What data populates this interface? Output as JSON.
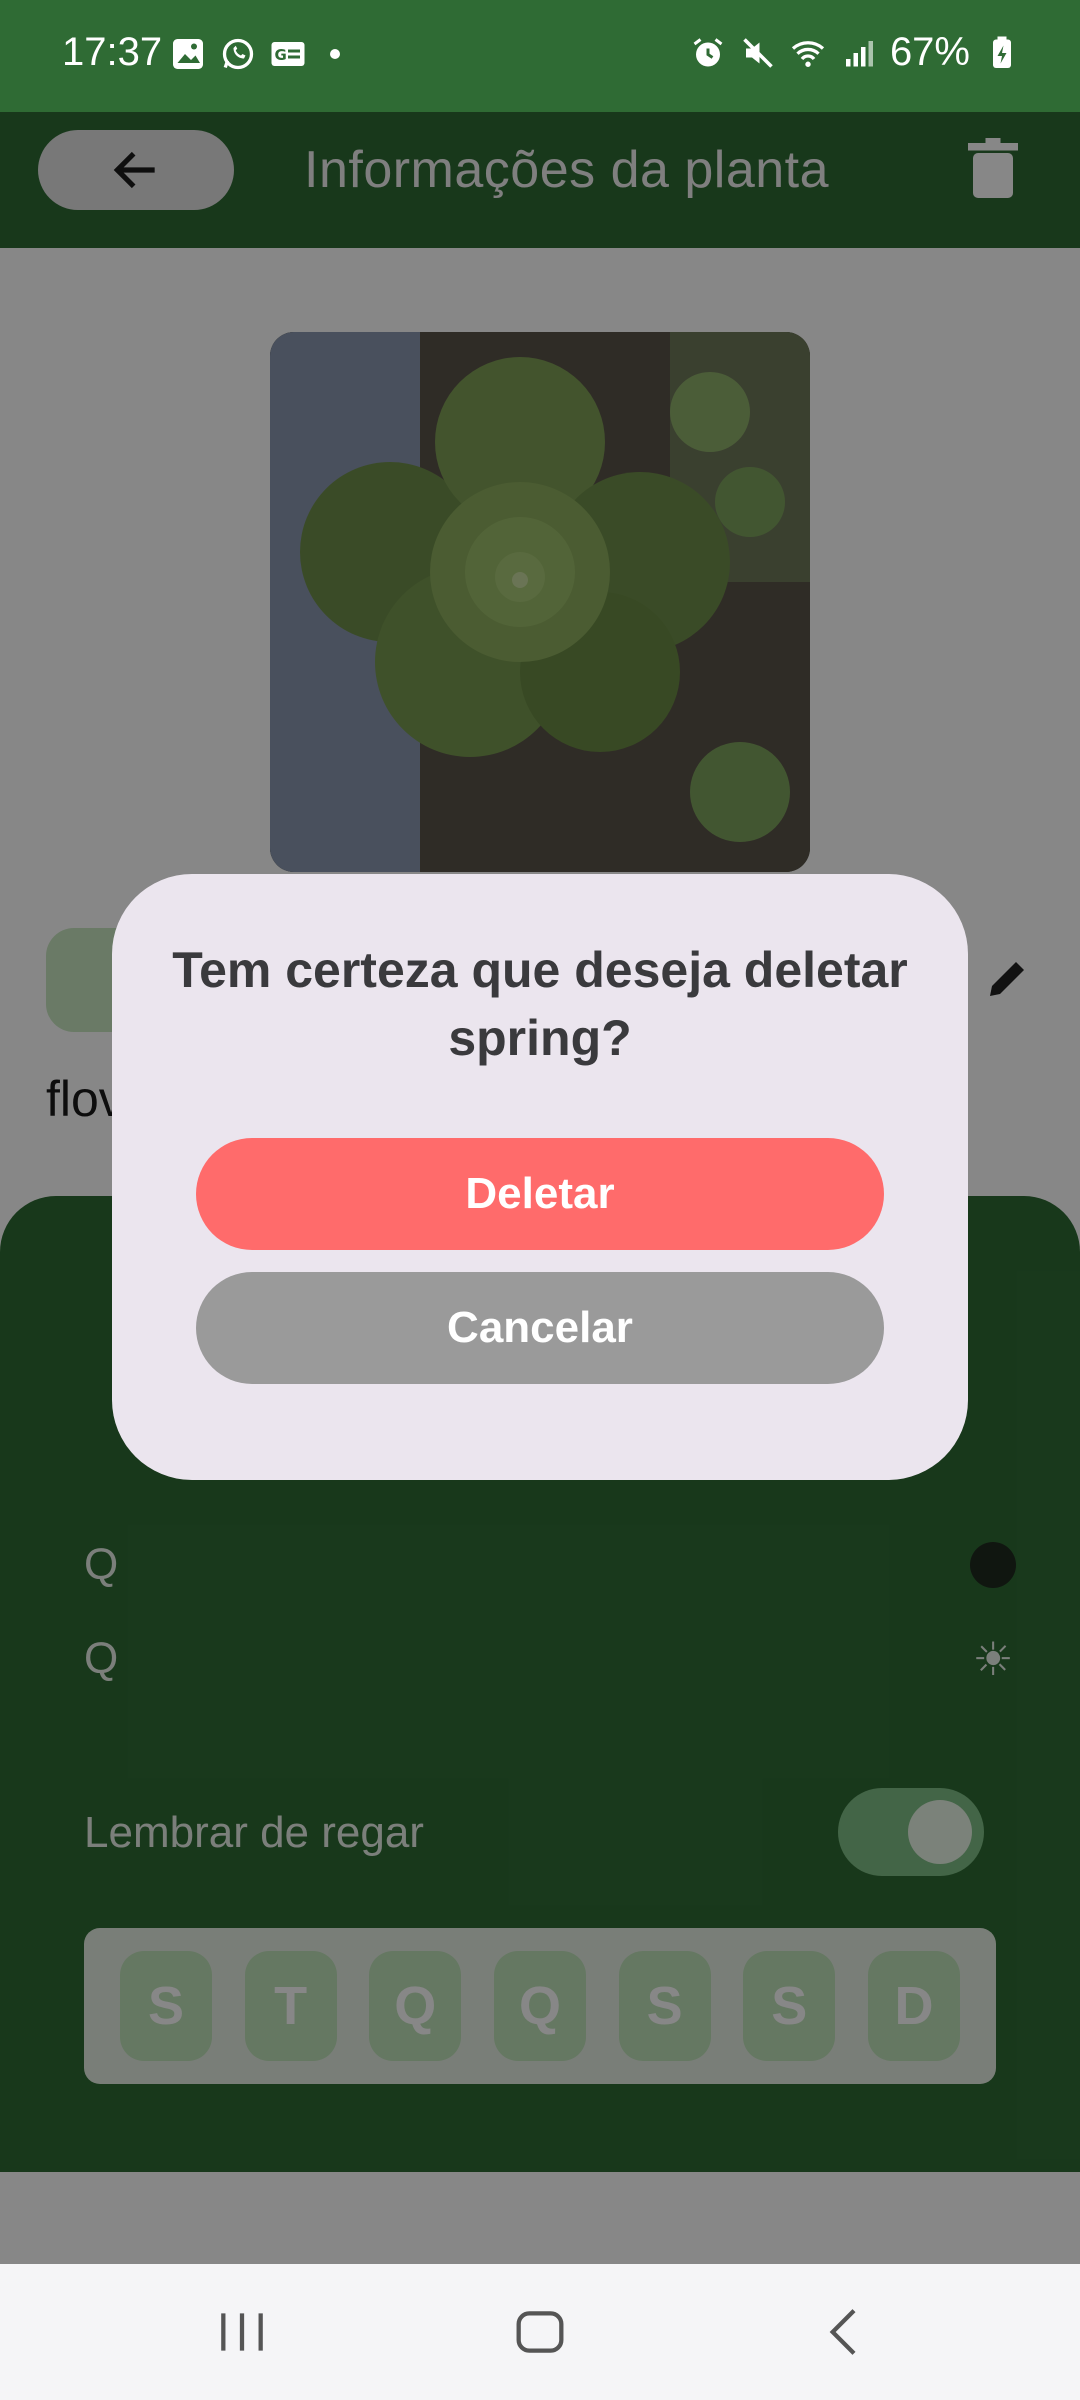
{
  "status_bar": {
    "time": "17:37",
    "battery": "67%",
    "icons_left": [
      "gallery-icon",
      "whatsapp-icon",
      "card-icon",
      "notification-dot"
    ],
    "icons_right": [
      "alarm-icon",
      "mute-icon",
      "wifi-icon",
      "signal-icon",
      "battery-icon"
    ]
  },
  "app_bar": {
    "title": "Informações da planta",
    "back_icon": "arrow-left-icon",
    "delete_icon": "trash-icon"
  },
  "plant": {
    "species_partial": "flov",
    "photo_icon": "plant-photo"
  },
  "care": {
    "row1_initial": "Q",
    "row2_initial": "Q",
    "remind_label": "Lembrar de regar",
    "remind_enabled": true,
    "days": [
      "S",
      "T",
      "Q",
      "Q",
      "S",
      "S",
      "D"
    ]
  },
  "dialog": {
    "title": "Tem certeza que deseja deletar spring?",
    "delete_label": "Deletar",
    "cancel_label": "Cancelar"
  },
  "nav_bar": {
    "recents_icon": "recents-icon",
    "home_icon": "home-icon",
    "back_icon": "back-icon"
  },
  "colors": {
    "primary_green": "#2f6b34",
    "delete_red": "#ff6b6b",
    "cancel_gray": "#9a9a9a",
    "dialog_bg": "#ebe5ee"
  }
}
